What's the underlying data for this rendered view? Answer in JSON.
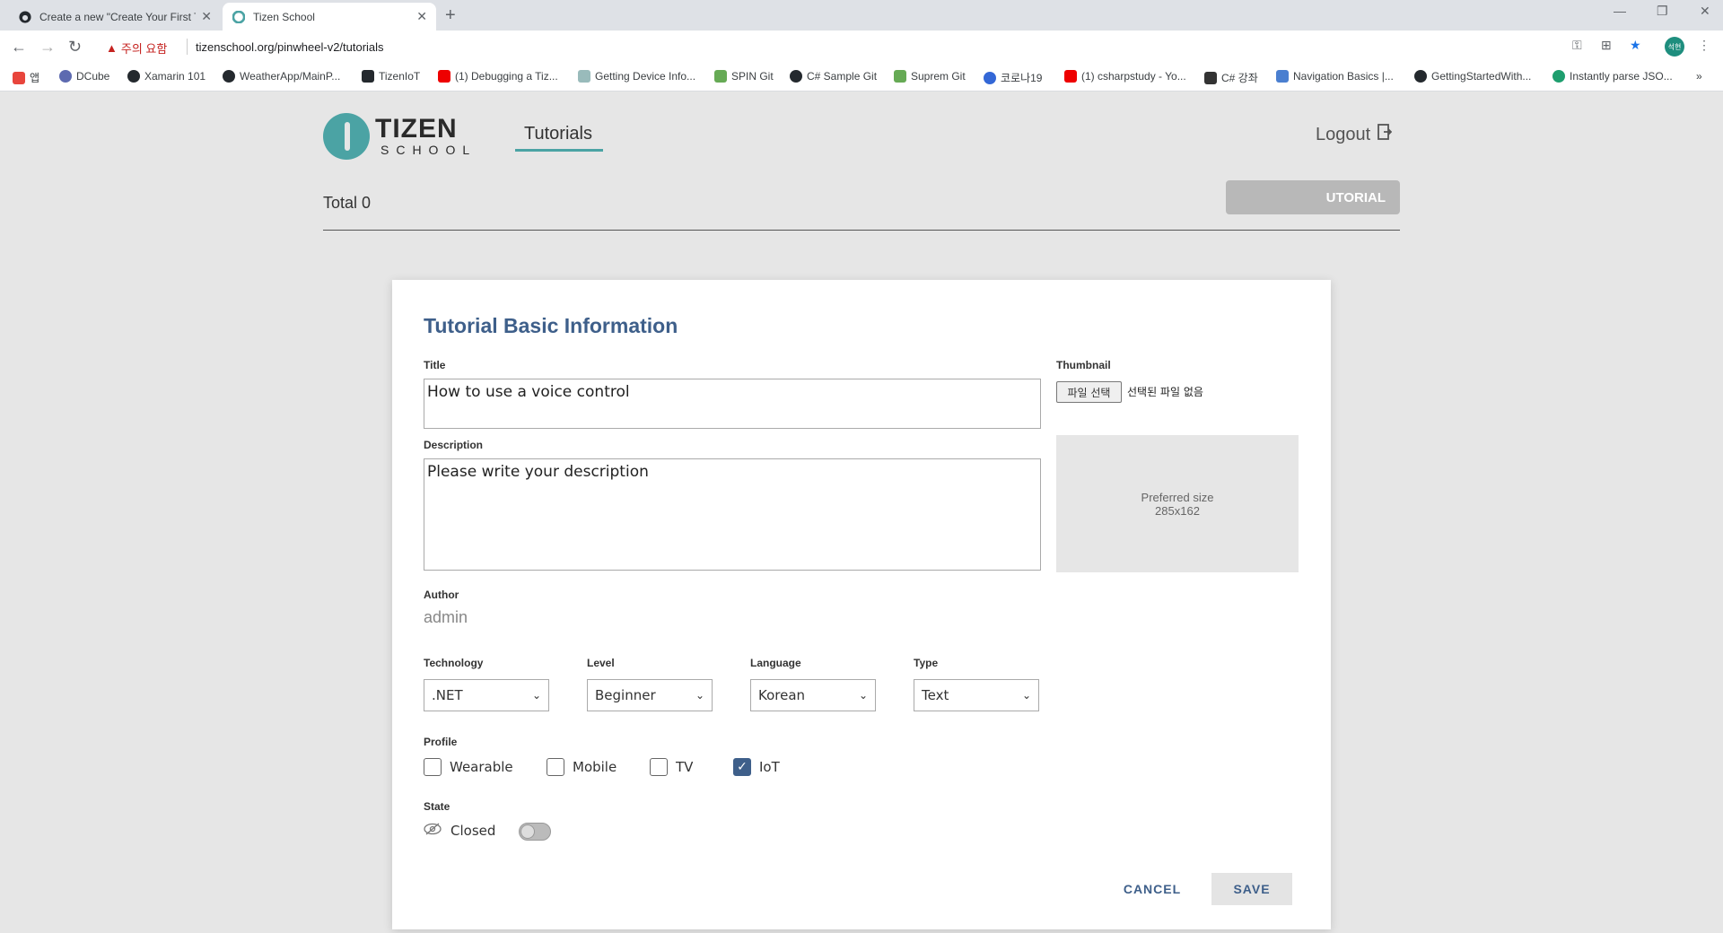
{
  "browser": {
    "tabs": [
      {
        "title": "Create a new \"Create Your First T",
        "icon": "github-icon"
      },
      {
        "title": "Tizen School",
        "icon": "tizen-icon"
      }
    ],
    "new_tab": "+",
    "warning": "주의 요함",
    "url": "tizenschool.org/pinwheel-v2/tutorials",
    "profile_initials": "석현",
    "bookmarks": [
      "앱",
      "DCube",
      "Xamarin 101",
      "WeatherApp/MainP...",
      "TizenIoT",
      "(1) Debugging a Tiz...",
      "Getting Device Info...",
      "SPIN Git",
      "C# Sample Git",
      "Suprem Git",
      "코로나19",
      "(1) csharpstudy - Yo...",
      "C# 강좌",
      "Navigation Basics |...",
      "GettingStartedWith...",
      "Instantly parse JSO...",
      "»"
    ]
  },
  "header": {
    "logo_main": "TIZEN",
    "logo_sub": "SCHOOL",
    "nav_tutorials": "Tutorials",
    "logout": "Logout",
    "total": "Total 0",
    "create_button": "UTORIAL"
  },
  "modal": {
    "title": "Tutorial Basic Information",
    "title_label": "Title",
    "title_value": "How to use a voice control",
    "description_label": "Description",
    "description_value": "Please write your description",
    "author_label": "Author",
    "author_value": "admin",
    "thumbnail_label": "Thumbnail",
    "file_button": "파일 선택",
    "file_none": "선택된 파일 없음",
    "preferred_line1": "Preferred size",
    "preferred_line2": "285x162",
    "technology_label": "Technology",
    "technology_value": ".NET",
    "level_label": "Level",
    "level_value": "Beginner",
    "language_label": "Language",
    "language_value": "Korean",
    "type_label": "Type",
    "type_value": "Text",
    "profile_label": "Profile",
    "profiles": [
      {
        "label": "Wearable",
        "checked": false
      },
      {
        "label": "Mobile",
        "checked": false
      },
      {
        "label": "TV",
        "checked": false
      },
      {
        "label": "IoT",
        "checked": true
      }
    ],
    "state_label": "State",
    "state_value": "Closed",
    "cancel": "CANCEL",
    "save": "SAVE"
  },
  "colors": {
    "accent": "#3e5f8a",
    "teal": "#4ba3a4"
  }
}
